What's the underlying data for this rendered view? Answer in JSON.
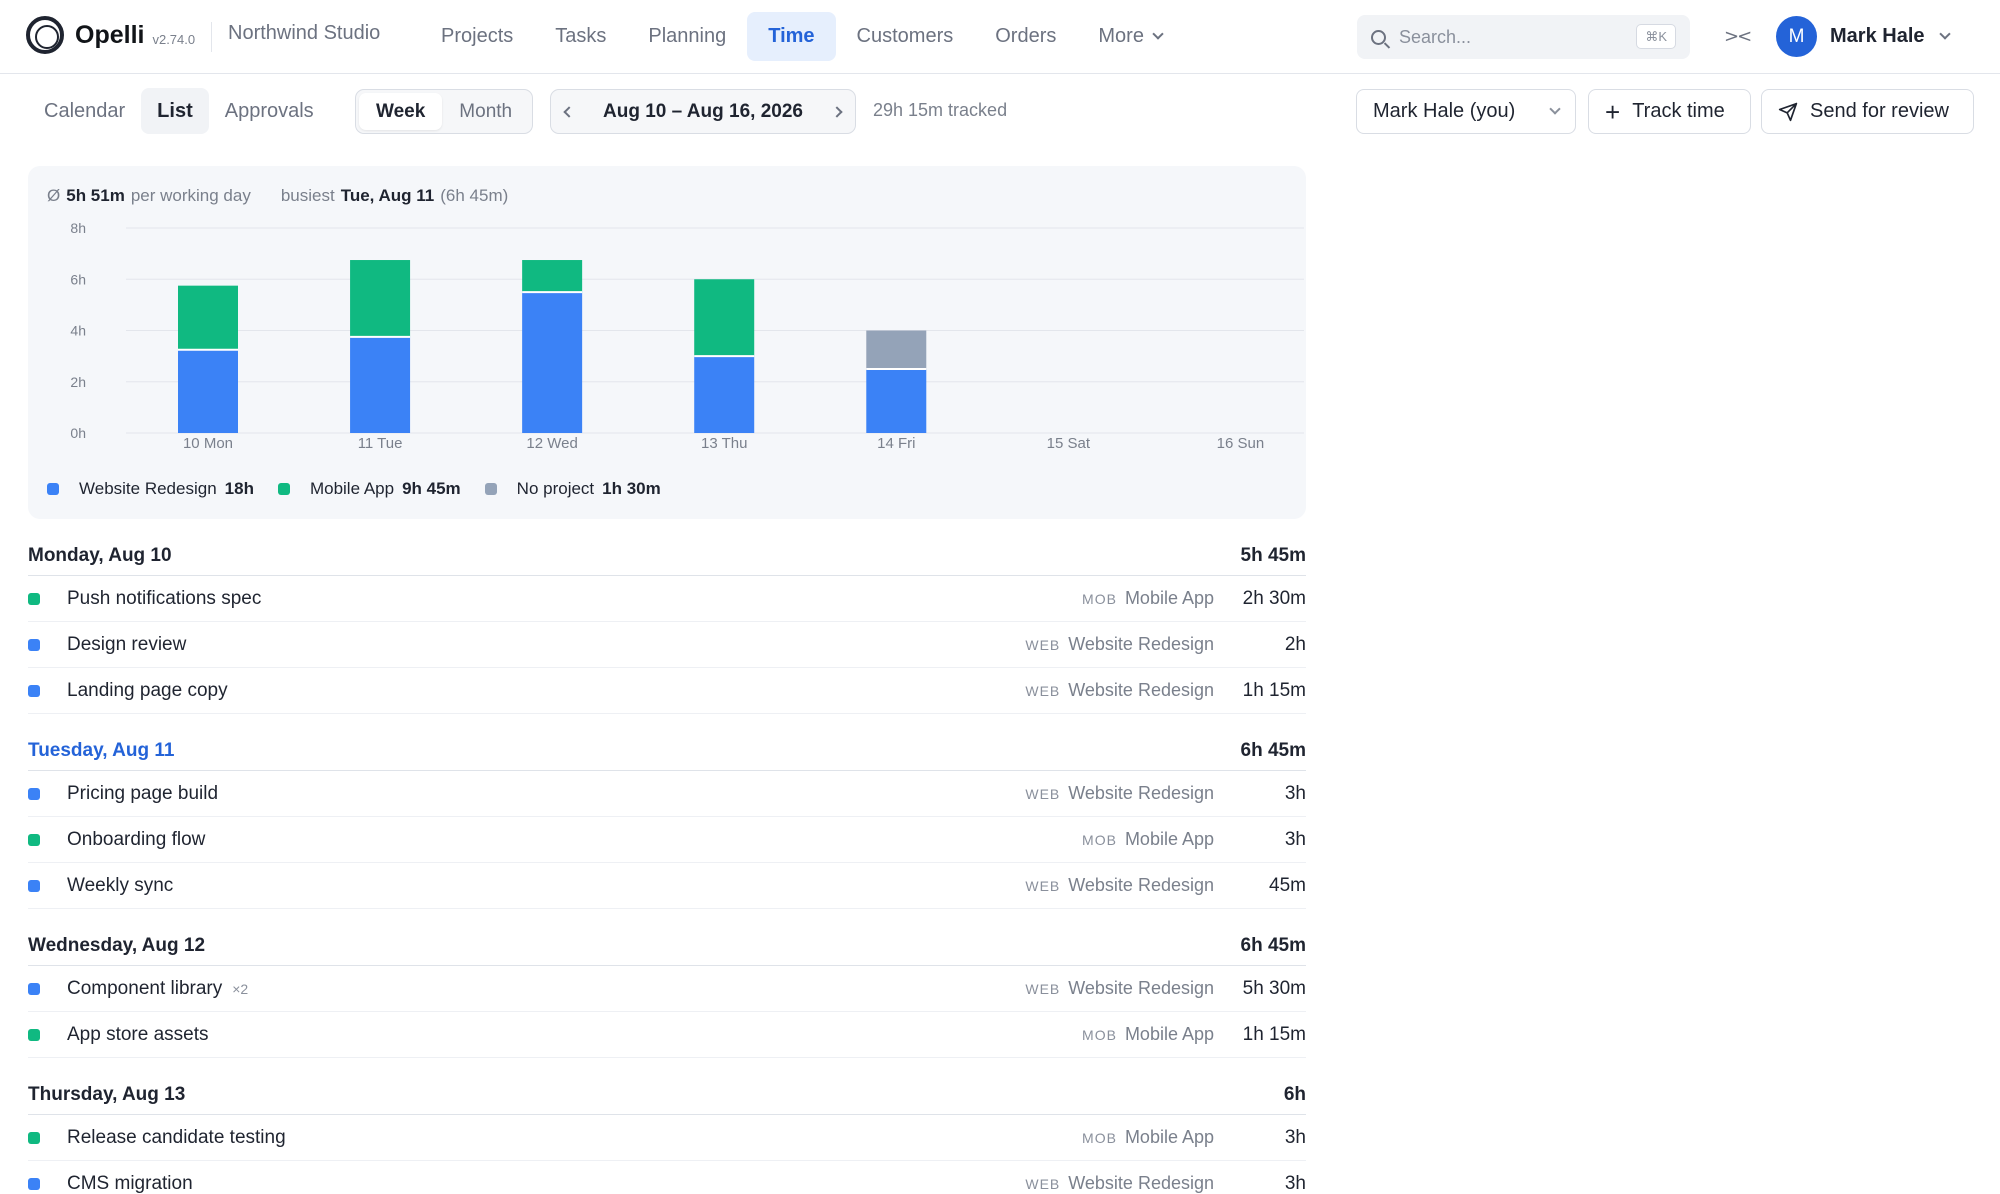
{
  "app": {
    "name": "Opelli",
    "version": "v2.74.0",
    "org": "Northwind Studio"
  },
  "nav": [
    {
      "label": "Projects",
      "active": false
    },
    {
      "label": "Tasks",
      "active": false
    },
    {
      "label": "Planning",
      "active": false
    },
    {
      "label": "Time",
      "active": true
    },
    {
      "label": "Customers",
      "active": false
    },
    {
      "label": "Orders",
      "active": false
    },
    {
      "label": "More",
      "active": false
    }
  ],
  "search": {
    "placeholder": "Search...",
    "shortcut": "⌘K"
  },
  "user": {
    "initial": "M",
    "name": "Mark Hale"
  },
  "toolbar": {
    "view_tabs": [
      {
        "label": "Calendar",
        "active": false
      },
      {
        "label": "List",
        "active": true
      },
      {
        "label": "Approvals",
        "active": false
      }
    ],
    "period": [
      {
        "label": "Week",
        "active": true
      },
      {
        "label": "Month",
        "active": false
      }
    ],
    "range": "Aug 10 – Aug 16, 2026",
    "tracked": "29h 15m tracked",
    "user_filter": "Mark Hale (you)",
    "track_time": "Track time",
    "send_review": "Send for review"
  },
  "summary": {
    "avg_symbol": "Ø",
    "avg_value": "5h 51m",
    "avg_label": "per working day",
    "busiest_label": "busiest",
    "busiest_day": "Tue, Aug 11",
    "busiest_value": "(6h 45m)"
  },
  "colors": {
    "web": "#3b82f6",
    "mob": "#10b981",
    "none": "#94a3b8",
    "accent": "#2463d8"
  },
  "chart_data": {
    "type": "bar",
    "stacked": true,
    "categories": [
      "10 Mon",
      "11 Tue",
      "12 Wed",
      "13 Thu",
      "14 Fri",
      "15 Sat",
      "16 Sun"
    ],
    "series": [
      {
        "name": "Website Redesign",
        "color": "#3b82f6",
        "values": [
          3.25,
          3.75,
          5.5,
          3.0,
          2.5,
          0,
          0
        ]
      },
      {
        "name": "Mobile App",
        "color": "#10b981",
        "values": [
          2.5,
          3.0,
          1.25,
          3.0,
          0,
          0,
          0
        ]
      },
      {
        "name": "No project",
        "color": "#94a3b8",
        "values": [
          0,
          0,
          0,
          0,
          1.5,
          0,
          0
        ]
      }
    ],
    "y_ticks": [
      "0h",
      "2h",
      "4h",
      "6h",
      "8h"
    ],
    "ylim": [
      0,
      8
    ],
    "grid": true
  },
  "legend": [
    {
      "name": "Website Redesign",
      "total": "18h",
      "color": "#3b82f6"
    },
    {
      "name": "Mobile App",
      "total": "9h 45m",
      "color": "#10b981"
    },
    {
      "name": "No project",
      "total": "1h 30m",
      "color": "#94a3b8"
    }
  ],
  "days": [
    {
      "title": "Monday, Aug 10",
      "total": "5h 45m",
      "today": false,
      "entries": [
        {
          "name": "Push notifications spec",
          "count": "",
          "code": "MOB",
          "project": "Mobile App",
          "duration": "2h 30m",
          "color": "#10b981"
        },
        {
          "name": "Design review",
          "count": "",
          "code": "WEB",
          "project": "Website Redesign",
          "duration": "2h",
          "color": "#3b82f6"
        },
        {
          "name": "Landing page copy",
          "count": "",
          "code": "WEB",
          "project": "Website Redesign",
          "duration": "1h 15m",
          "color": "#3b82f6"
        }
      ]
    },
    {
      "title": "Tuesday, Aug 11",
      "total": "6h 45m",
      "today": true,
      "entries": [
        {
          "name": "Pricing page build",
          "count": "",
          "code": "WEB",
          "project": "Website Redesign",
          "duration": "3h",
          "color": "#3b82f6"
        },
        {
          "name": "Onboarding flow",
          "count": "",
          "code": "MOB",
          "project": "Mobile App",
          "duration": "3h",
          "color": "#10b981"
        },
        {
          "name": "Weekly sync",
          "count": "",
          "code": "WEB",
          "project": "Website Redesign",
          "duration": "45m",
          "color": "#3b82f6"
        }
      ]
    },
    {
      "title": "Wednesday, Aug 12",
      "total": "6h 45m",
      "today": false,
      "entries": [
        {
          "name": "Component library",
          "count": "×2",
          "code": "WEB",
          "project": "Website Redesign",
          "duration": "5h 30m",
          "color": "#3b82f6"
        },
        {
          "name": "App store assets",
          "count": "",
          "code": "MOB",
          "project": "Mobile App",
          "duration": "1h 15m",
          "color": "#10b981"
        }
      ]
    },
    {
      "title": "Thursday, Aug 13",
      "total": "6h",
      "today": false,
      "entries": [
        {
          "name": "Release candidate testing",
          "count": "",
          "code": "MOB",
          "project": "Mobile App",
          "duration": "3h",
          "color": "#10b981"
        },
        {
          "name": "CMS migration",
          "count": "",
          "code": "WEB",
          "project": "Website Redesign",
          "duration": "3h",
          "color": "#3b82f6"
        }
      ]
    }
  ]
}
